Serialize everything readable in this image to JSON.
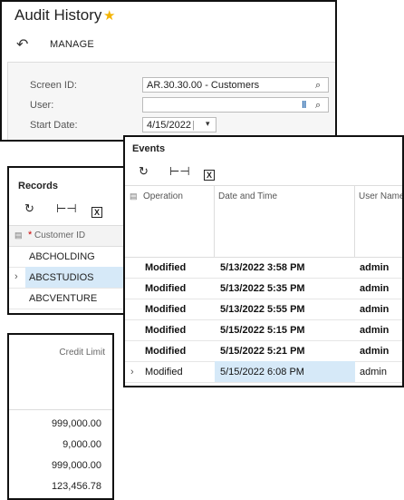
{
  "audit": {
    "title": "Audit History",
    "manage_label": "MANAGE",
    "fields": {
      "screen_id_label": "Screen ID:",
      "screen_id_value": "AR.30.30.00 - Customers",
      "user_label": "User:",
      "user_value": "",
      "start_date_label": "Start Date:",
      "start_date_value": "4/15/2022"
    }
  },
  "records": {
    "title": "Records",
    "required_mark": "*",
    "column": "Customer ID",
    "rows": [
      "ABCHOLDING",
      "ABCSTUDIOS",
      "ABCVENTURE"
    ]
  },
  "credit": {
    "column": "Credit Limit",
    "rows": [
      "999,000.00",
      "9,000.00",
      "999,000.00",
      "123,456.78"
    ]
  },
  "events": {
    "title": "Events",
    "columns": [
      "Operation",
      "Date and Time",
      "User Name"
    ],
    "rows": [
      {
        "operation": "Modified",
        "datetime": "5/13/2022 3:58 PM",
        "user": "admin"
      },
      {
        "operation": "Modified",
        "datetime": "5/13/2022 5:35 PM",
        "user": "admin"
      },
      {
        "operation": "Modified",
        "datetime": "5/13/2022 5:55 PM",
        "user": "admin"
      },
      {
        "operation": "Modified",
        "datetime": "5/15/2022 5:15 PM",
        "user": "admin"
      },
      {
        "operation": "Modified",
        "datetime": "5/15/2022 5:21 PM",
        "user": "admin"
      },
      {
        "operation": "Modified",
        "datetime": "5/15/2022 6:08 PM",
        "user": "admin"
      }
    ]
  },
  "colors": {
    "accent_star": "#f4b400",
    "selection": "#d6e9f8"
  }
}
